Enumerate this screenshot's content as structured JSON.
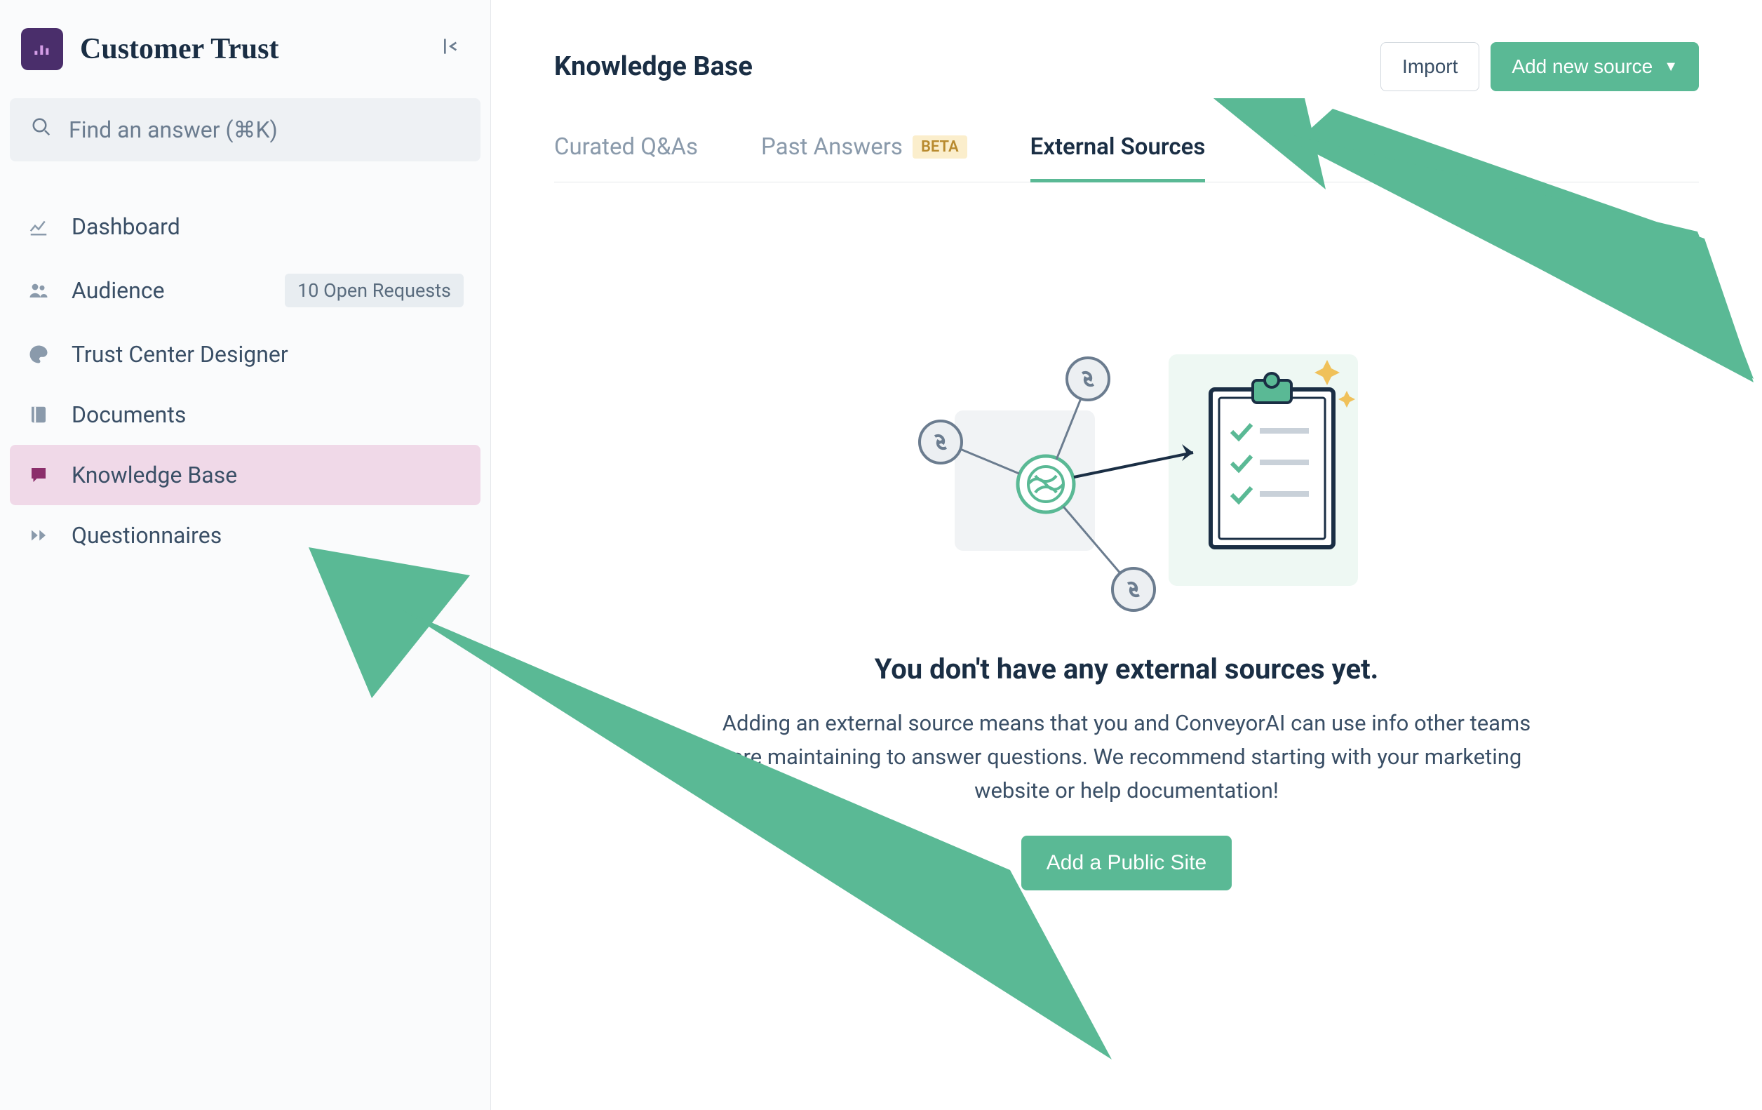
{
  "sidebar": {
    "title": "Customer Trust",
    "search_placeholder": "Find an answer (⌘K)",
    "items": [
      {
        "label": "Dashboard"
      },
      {
        "label": "Audience",
        "badge": "10 Open Requests"
      },
      {
        "label": "Trust Center Designer"
      },
      {
        "label": "Documents"
      },
      {
        "label": "Knowledge Base"
      },
      {
        "label": "Questionnaires"
      }
    ]
  },
  "header": {
    "title": "Knowledge Base",
    "import_label": "Import",
    "add_source_label": "Add new source"
  },
  "tabs": {
    "curated": "Curated Q&As",
    "past": "Past Answers",
    "beta_tag": "BETA",
    "external": "External Sources"
  },
  "empty": {
    "title": "You don't have any external sources yet.",
    "body": "Adding an external source means that you and ConveyorAI can use info other teams are maintaining to answer questions. We recommend starting with your marketing website or help documentation!",
    "cta": "Add a Public Site"
  }
}
